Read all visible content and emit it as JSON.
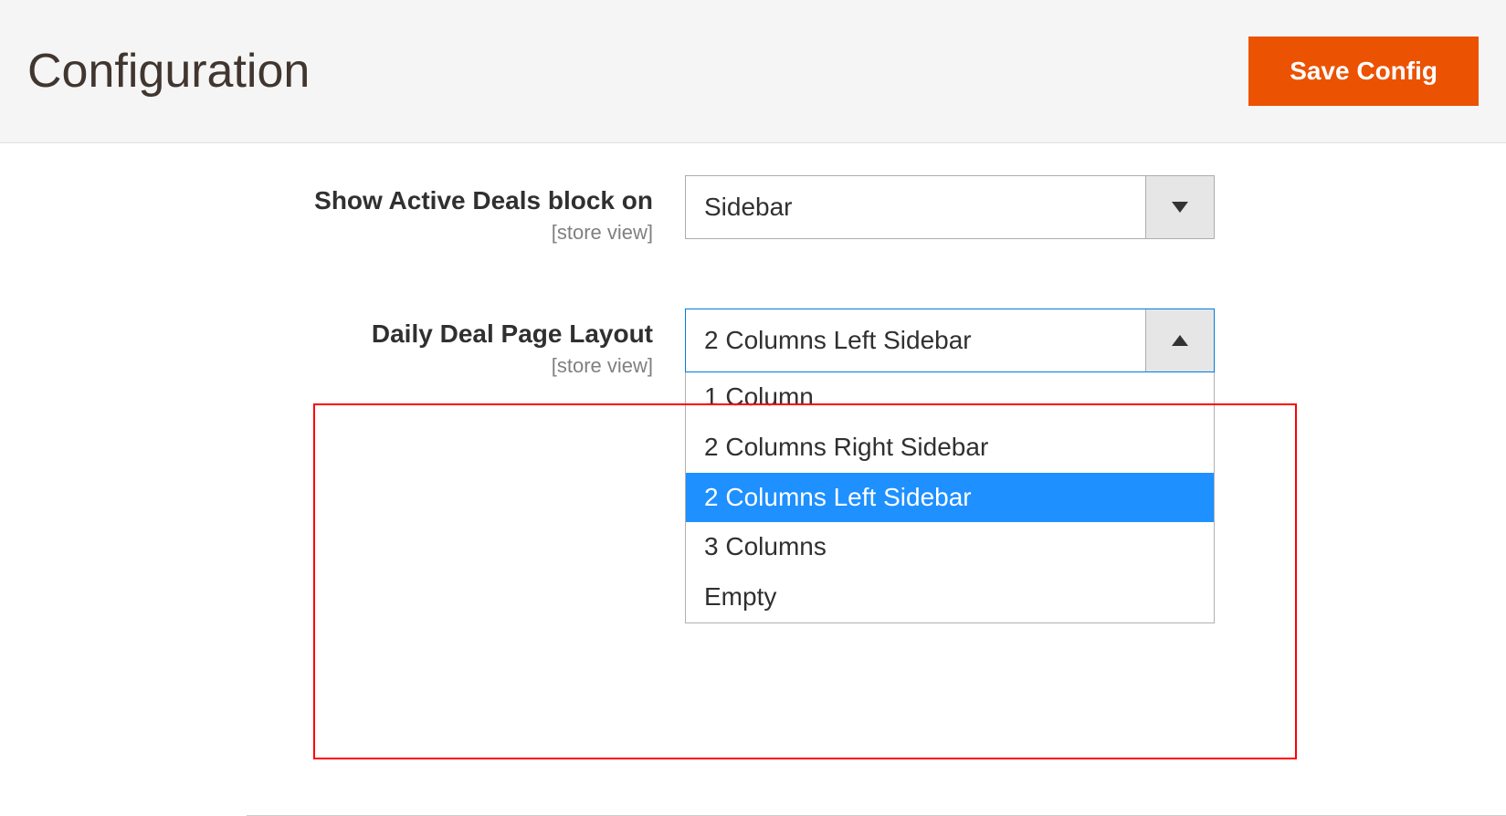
{
  "header": {
    "title": "Configuration",
    "save_label": "Save Config"
  },
  "fields": {
    "show_active_deals": {
      "label": "Show Active Deals block on",
      "scope": "[store view]",
      "value": "Sidebar"
    },
    "daily_deal_layout": {
      "label": "Daily Deal Page Layout",
      "scope": "[store view]",
      "value": "2 Columns Left Sidebar",
      "options": [
        "1 Column",
        "2 Columns Right Sidebar",
        "2 Columns Left Sidebar",
        "3 Columns",
        "Empty"
      ]
    }
  }
}
